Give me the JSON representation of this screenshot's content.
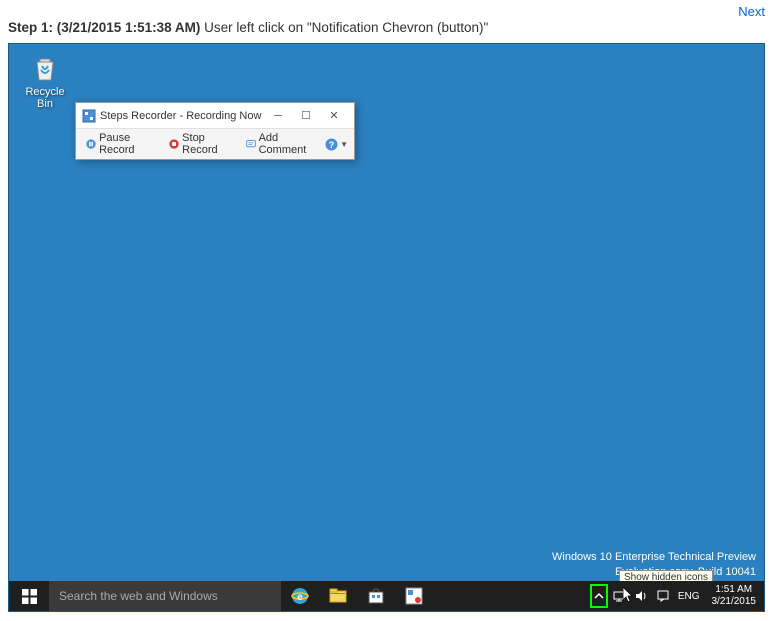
{
  "nav": {
    "next": "Next"
  },
  "step": {
    "label": "Step 1: (3/21/2015 1:51:38 AM)",
    "description": "User left click on \"Notification Chevron (button)\""
  },
  "desktop": {
    "recycle_bin": {
      "label": "Recycle Bin"
    },
    "watermark": {
      "line1": "Windows 10 Enterprise Technical Preview",
      "line2": "Evaluation copy. Build 10041"
    }
  },
  "steps_recorder": {
    "title": "Steps Recorder - Recording Now",
    "pause": "Pause Record",
    "stop": "Stop Record",
    "comment": "Add Comment"
  },
  "taskbar": {
    "search_placeholder": "Search the web and Windows",
    "tooltip": "Show hidden icons",
    "lang": "ENG",
    "time": "1:51 AM",
    "date": "3/21/2015"
  }
}
